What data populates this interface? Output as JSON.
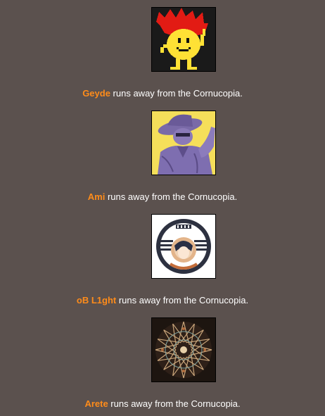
{
  "events": [
    {
      "tribute": "Geyde",
      "action": " runs away from the Cornucopia.",
      "avatar_icon": "pixel-flame-character-avatar"
    },
    {
      "tribute": "Ami",
      "action": " runs away from the Cornucopia.",
      "avatar_icon": "hat-figure-illustration-avatar"
    },
    {
      "tribute": "oB L1ght",
      "action": " runs away from the Cornucopia.",
      "avatar_icon": "light-emblem-avatar"
    },
    {
      "tribute": "Arete",
      "action": " runs away from the Cornucopia.",
      "avatar_icon": "kaleidoscope-star-avatar"
    }
  ],
  "colors": {
    "background": "#5b514e",
    "tribute_name": "#ff8c1a",
    "text": "#ffffff"
  }
}
